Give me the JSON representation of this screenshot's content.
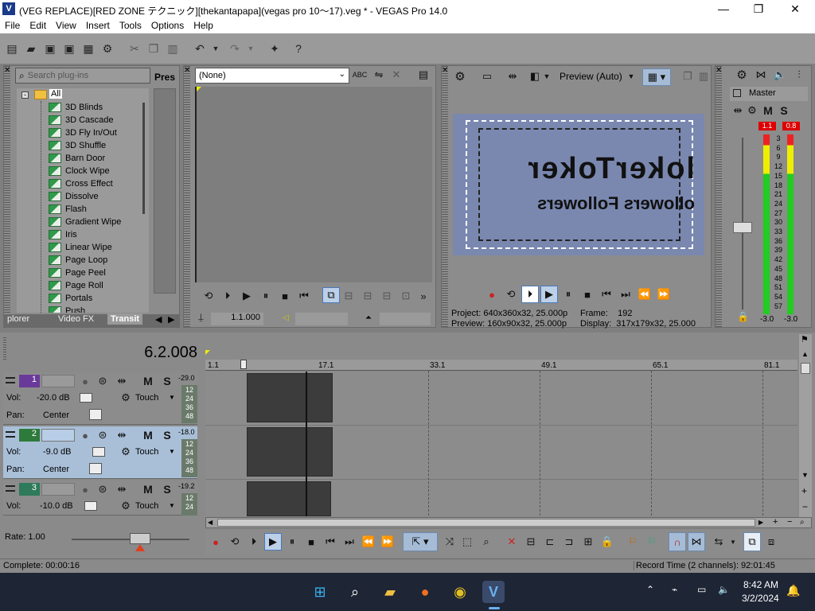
{
  "title_bar": {
    "title": "(VEG REPLACE)[RED ZONE テクニック][thekantapapa](vegas pro 10～17).veg * - VEGAS Pro 14.0",
    "minimize": "—",
    "maximize": "❐",
    "close": "✕"
  },
  "menu": [
    "File",
    "Edit",
    "View",
    "Insert",
    "Tools",
    "Options",
    "Help"
  ],
  "plugin_panel": {
    "search_placeholder": "Search plug-ins",
    "presets_label": "Pres",
    "root": "All",
    "items": [
      "3D Blinds",
      "3D Cascade",
      "3D Fly In/Out",
      "3D Shuffle",
      "Barn Door",
      "Clock Wipe",
      "Cross Effect",
      "Dissolve",
      "Flash",
      "Gradient Wipe",
      "Iris",
      "Linear Wipe",
      "Page Loop",
      "Page Peel",
      "Page Roll",
      "Portals",
      "Push"
    ],
    "tabs": [
      "plorer",
      "Video FX",
      "Transit"
    ]
  },
  "trimmer": {
    "dropdown": "(None)",
    "time": "1.1.000"
  },
  "preview": {
    "mode": "Preview (Auto)",
    "text_line1": "lokerToker",
    "text_line2": "ollowers Followers",
    "project_label": "Project:",
    "project_value": "640x360x32, 25.000p",
    "preview_label": "Preview:",
    "preview_value": "160x90x32, 25.000p",
    "frame_label": "Frame:",
    "frame_value": "192",
    "display_label": "Display:",
    "display_value": "317x179x32, 25.000"
  },
  "master": {
    "label": "Master",
    "m": "M",
    "s": "S",
    "peak_left": "1.1",
    "peak_right": "0.8",
    "scale": [
      "3",
      "6",
      "9",
      "12",
      "15",
      "18",
      "21",
      "24",
      "27",
      "30",
      "33",
      "36",
      "39",
      "42",
      "45",
      "48",
      "51",
      "54",
      "57"
    ],
    "bottom_left": "-3.0",
    "bottom_right": "-3.0"
  },
  "timeline": {
    "time": "6.2.008",
    "ruler": [
      "1.1",
      "17.1",
      "33.1",
      "49.1",
      "65.1",
      "81.1"
    ],
    "tracks": [
      {
        "num": "1",
        "vol_label": "Vol:",
        "vol": "-20.0 dB",
        "pan_label": "Pan:",
        "pan": "Center",
        "mode": "Touch",
        "db": "-29.0",
        "m": "M",
        "s": "S",
        "color": "#6a3a9a",
        "selected": false
      },
      {
        "num": "2",
        "vol_label": "Vol:",
        "vol": "-9.0 dB",
        "pan_label": "Pan:",
        "pan": "Center",
        "mode": "Touch",
        "db": "-18.0",
        "m": "M",
        "s": "S",
        "color": "#2e7a3a",
        "selected": true
      },
      {
        "num": "3",
        "vol_label": "Vol:",
        "vol": "-10.0 dB",
        "pan_label": "Pan:",
        "pan": "",
        "mode": "Touch",
        "db": "-19.2",
        "m": "M",
        "s": "S",
        "color": "#2e7a5a",
        "selected": false
      }
    ],
    "mini_scale": [
      "12",
      "24",
      "36",
      "48"
    ]
  },
  "rate": {
    "label": "Rate: 1.00"
  },
  "status": {
    "complete": "Complete: 00:00:16",
    "record": "Record Time (2 channels): 92:01:45"
  },
  "taskbar": {
    "time": "8:42 AM",
    "date": "3/2/2024"
  }
}
